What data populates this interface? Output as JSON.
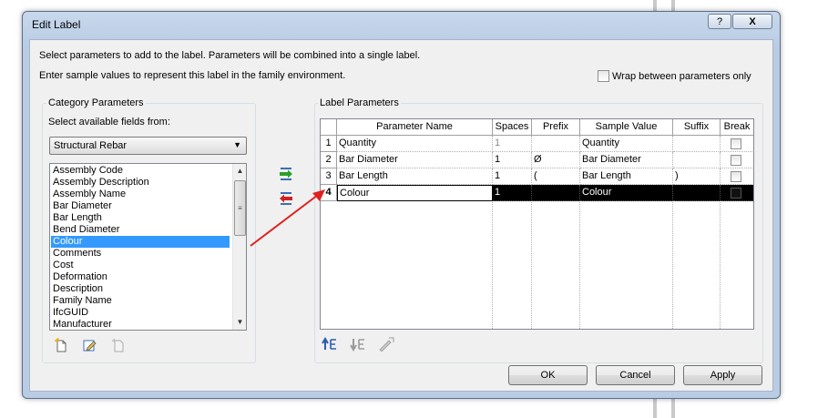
{
  "window": {
    "title": "Edit Label",
    "help_label": "?",
    "close_label": "X"
  },
  "instructions": {
    "line1": "Select parameters to add to the label.  Parameters will be combined into a single label.",
    "line2": "Enter sample values to represent this label in the family environment."
  },
  "wrap_option": {
    "label": "Wrap between parameters only",
    "checked": false
  },
  "category_parameters": {
    "title": "Category Parameters",
    "select_label": "Select available fields from:",
    "selected_category": "Structural Rebar",
    "fields": [
      "Assembly Code",
      "Assembly Description",
      "Assembly Name",
      "Bar Diameter",
      "Bar Length",
      "Bend Diameter",
      "Colour",
      "Comments",
      "Cost",
      "Deformation",
      "Description",
      "Family Name",
      "IfcGUID",
      "Manufacturer"
    ],
    "selected_field": "Colour"
  },
  "label_parameters": {
    "title": "Label Parameters",
    "columns": [
      "Parameter Name",
      "Spaces",
      "Prefix",
      "Sample Value",
      "Suffix",
      "Break"
    ],
    "rows": [
      {
        "num": "1",
        "name": "Quantity",
        "spaces": "1",
        "prefix": "",
        "sample": "Quantity",
        "suffix": "",
        "break": false
      },
      {
        "num": "2",
        "name": "Bar Diameter",
        "spaces": "1",
        "prefix": "Ø",
        "sample": "Bar Diameter",
        "suffix": "",
        "break": false
      },
      {
        "num": "3",
        "name": "Bar Length",
        "spaces": "1",
        "prefix": "(",
        "sample": "Bar Length",
        "suffix": ")",
        "break": false
      },
      {
        "num": "4",
        "name": "Colour",
        "spaces": "1",
        "prefix": "",
        "sample": "Colour",
        "suffix": "",
        "break": false
      }
    ],
    "selected_row": 4
  },
  "buttons": {
    "ok": "OK",
    "cancel": "Cancel",
    "apply": "Apply"
  },
  "colors": {
    "accent_selection": "#3399ff",
    "annotation_arrow": "#e02020"
  }
}
